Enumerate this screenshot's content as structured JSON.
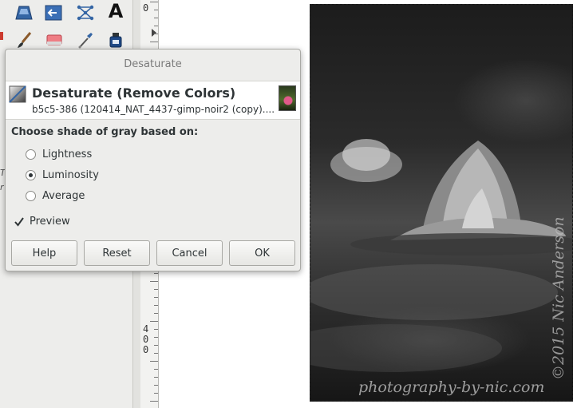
{
  "dialog": {
    "title": "Desaturate",
    "header_title": "Desaturate (Remove Colors)",
    "header_subtitle": "b5c5-386 (120414_NAT_4437-gimp-noir2 (copy)....",
    "section_label": "Choose shade of gray based on:",
    "options": [
      {
        "label": "Lightness",
        "selected": false
      },
      {
        "label": "Luminosity",
        "selected": true
      },
      {
        "label": "Average",
        "selected": false
      }
    ],
    "preview_label": "Preview",
    "preview_checked": true,
    "buttons": {
      "help": "Help",
      "reset": "Reset",
      "cancel": "Cancel",
      "ok": "OK"
    }
  },
  "ruler": {
    "top_number": "0",
    "bottom_digits": [
      "4",
      "0",
      "0"
    ]
  },
  "toolbox": {
    "text_tool_glyph": "A",
    "partial_text": [
      "Ti",
      "r"
    ],
    "icons": [
      "perspective-icon",
      "flip-icon",
      "cage-transform-icon",
      "text-tool-icon",
      "paintbrush-icon",
      "eraser-icon",
      "color-picker-icon",
      "ink-bottle-icon"
    ]
  },
  "image": {
    "watermark": "photography-by-nic.com",
    "copyright": "©2015 Nic Anderson"
  },
  "colors": {
    "dialog_bg": "#ededeb",
    "header_bg": "#ffffff",
    "accent_blue": "#3465a4"
  }
}
